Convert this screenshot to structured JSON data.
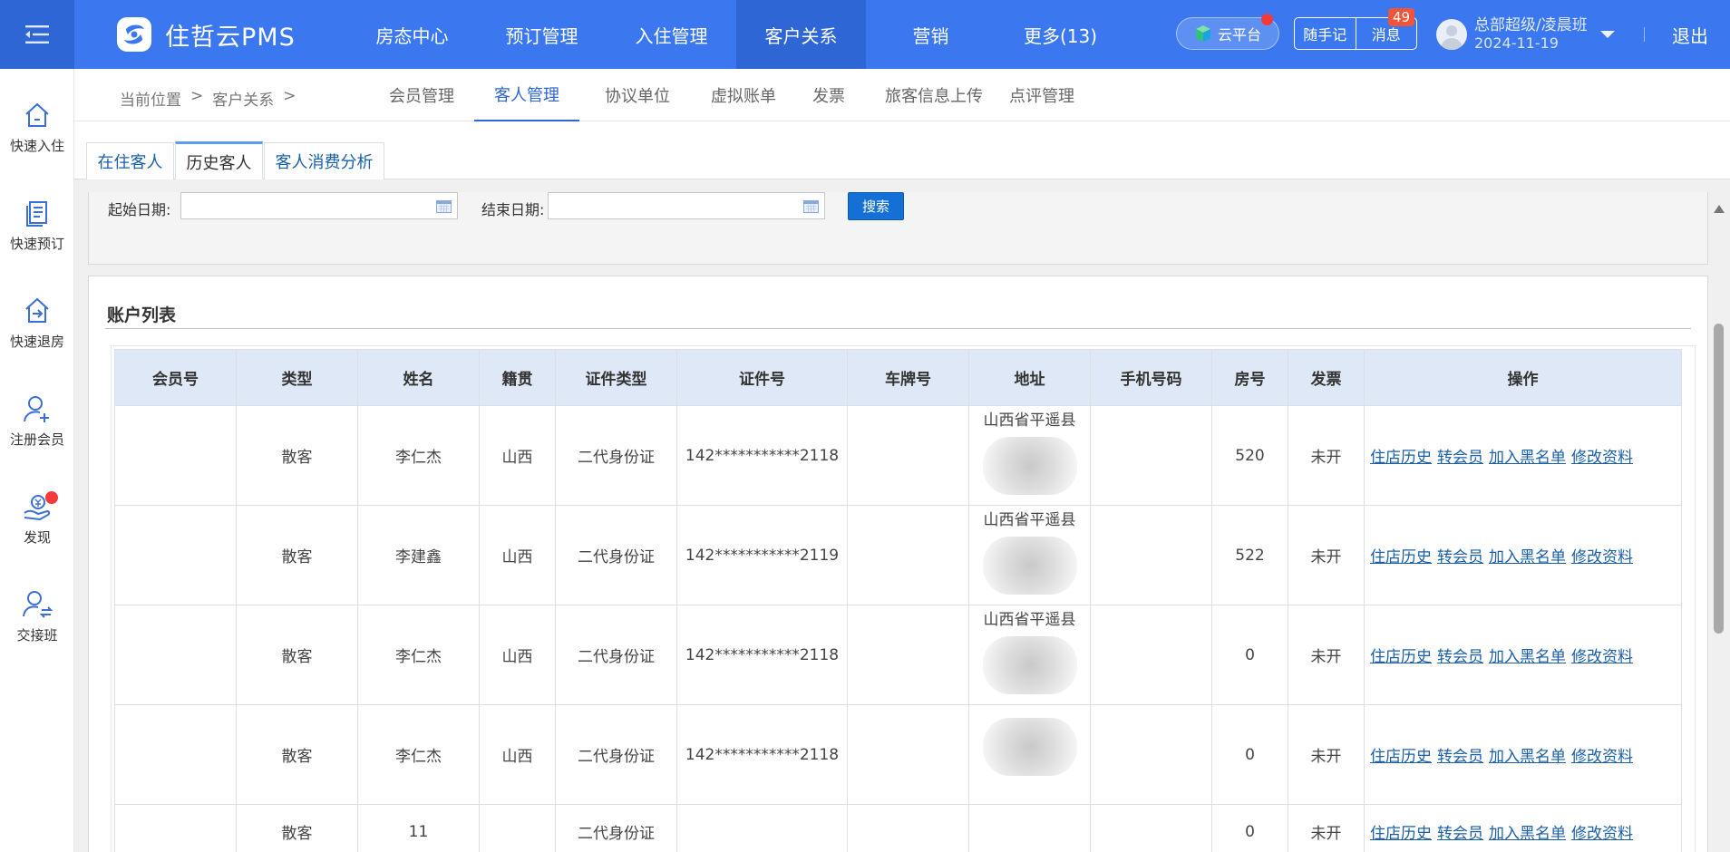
{
  "app": {
    "logo_text": "住哲云PMS",
    "nav": [
      {
        "label": "房态中心",
        "active": false
      },
      {
        "label": "预订管理",
        "active": false
      },
      {
        "label": "入住管理",
        "active": false
      },
      {
        "label": "客户关系",
        "active": true
      },
      {
        "label": "营销",
        "active": false
      },
      {
        "label": "更多(13)",
        "active": false
      }
    ],
    "cloud_label": "云平台",
    "notes_label": "随手记",
    "msg_label": "消息",
    "msg_count": "49",
    "user_name": "总部超级/凌晨班",
    "user_date": "2024-11-19",
    "logout_label": "退出"
  },
  "sidebar": {
    "items": [
      {
        "label": "快速入住",
        "icon": "quick-checkin-icon"
      },
      {
        "label": "快速预订",
        "icon": "quick-booking-icon"
      },
      {
        "label": "快速退房",
        "icon": "quick-checkout-icon"
      },
      {
        "label": "注册会员",
        "icon": "register-member-icon"
      },
      {
        "label": "发现",
        "icon": "discover-icon"
      },
      {
        "label": "交接班",
        "icon": "shift-handover-icon"
      }
    ]
  },
  "breadcrumb": {
    "prefix": "当前位置",
    "sep": ">",
    "section": "客户关系"
  },
  "subnav": [
    {
      "label": "会员管理",
      "active": false
    },
    {
      "label": "客人管理",
      "active": true
    },
    {
      "label": "协议单位",
      "active": false
    },
    {
      "label": "虚拟账单",
      "active": false
    },
    {
      "label": "发票",
      "active": false
    },
    {
      "label": "旅客信息上传",
      "active": false
    },
    {
      "label": "点评管理",
      "active": false
    }
  ],
  "tabs": [
    {
      "label": "在住客人",
      "active": false
    },
    {
      "label": "历史客人",
      "active": true
    },
    {
      "label": "客人消费分析",
      "active": false
    }
  ],
  "search": {
    "start_label": "起始日期:",
    "start_value": "",
    "end_label": "结束日期:",
    "end_value": "",
    "button_label": "搜索"
  },
  "list": {
    "title": "账户列表",
    "columns": [
      "会员号",
      "类型",
      "姓名",
      "籍贯",
      "证件类型",
      "证件号",
      "车牌号",
      "地址",
      "手机号码",
      "房号",
      "发票",
      "操作"
    ],
    "actions": [
      "住店历史",
      "转会员",
      "加入黑名单",
      "修改资料"
    ],
    "rows": [
      {
        "member": "",
        "type": "散客",
        "name": "李仁杰",
        "origin": "山西",
        "id_type": "二代身份证",
        "id_no": "142***********2118",
        "plate": "",
        "address": "山西省平遥县",
        "phone": "",
        "room": "520",
        "invoice": "未开"
      },
      {
        "member": "",
        "type": "散客",
        "name": "李建鑫",
        "origin": "山西",
        "id_type": "二代身份证",
        "id_no": "142***********2119",
        "plate": "",
        "address": "山西省平遥县",
        "phone": "",
        "room": "522",
        "invoice": "未开"
      },
      {
        "member": "",
        "type": "散客",
        "name": "李仁杰",
        "origin": "山西",
        "id_type": "二代身份证",
        "id_no": "142***********2118",
        "plate": "",
        "address": "山西省平遥县",
        "phone": "",
        "room": "0",
        "invoice": "未开"
      },
      {
        "member": "",
        "type": "散客",
        "name": "李仁杰",
        "origin": "山西",
        "id_type": "二代身份证",
        "id_no": "142***********2118",
        "plate": "",
        "address": "",
        "phone": "",
        "room": "0",
        "invoice": "未开"
      },
      {
        "member": "",
        "type": "散客",
        "name": "11",
        "origin": "",
        "id_type": "二代身份证",
        "id_no": "",
        "plate": "",
        "address": "",
        "phone": "",
        "room": "0",
        "invoice": "未开"
      }
    ]
  },
  "colors": {
    "topbar": "#3b78f0",
    "topbar_active": "#2f66d6",
    "link": "#1b5fa8",
    "table_header": "#dfe8f6",
    "badge": "#f0553a"
  }
}
